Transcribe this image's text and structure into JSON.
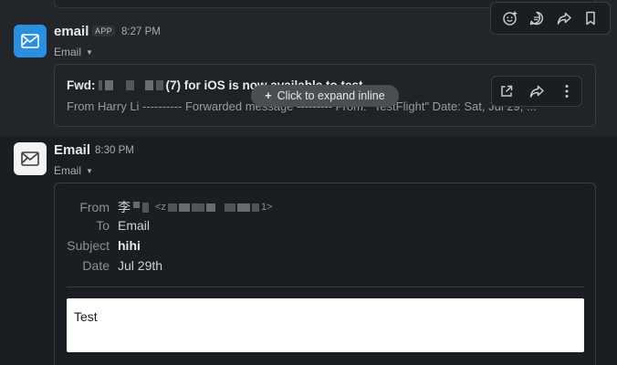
{
  "colors": {
    "background": "#1a1d21",
    "hover_row": "#222529",
    "avatar_blue": "#2b8fe0",
    "pill": "#4a4d51"
  },
  "message1": {
    "sender": "email",
    "badge": "APP",
    "time": "8:27 PM",
    "subtitle": "Email",
    "subject_prefix": "Fwd:",
    "subject_suffix": "(7) for iOS is now available to test",
    "preview": "From Harry Li  ---------- Forwarded message --------- From: \"TestFlight\" Date: Sat, Jul 29, ...",
    "expand_label": "Click to expand inline",
    "icons": [
      "emoji-reaction-icon",
      "reply-thread-icon",
      "share-icon",
      "bookmark-icon"
    ],
    "card_icons": [
      "open-external-icon",
      "share-icon",
      "more-vertical-icon"
    ]
  },
  "message2": {
    "sender": "Email",
    "time": "8:30 PM",
    "subtitle": "Email",
    "headers": {
      "from_label": "From",
      "from_name": "李",
      "from_addr_open": "<z",
      "from_addr_close": "1>",
      "to_label": "To",
      "to_value": "Email",
      "subject_label": "Subject",
      "subject_value": "hihi",
      "date_label": "Date",
      "date_value": "Jul 29th"
    },
    "body": "Test"
  }
}
